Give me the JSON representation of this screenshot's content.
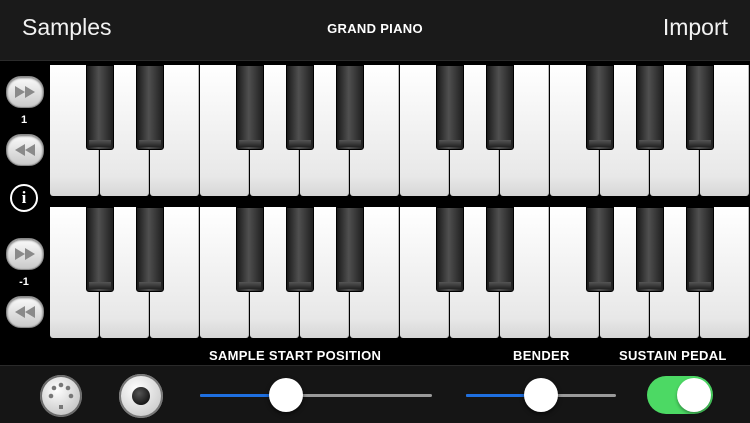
{
  "header": {
    "samples_label": "Samples",
    "title": "GRAND PIANO",
    "import_label": "Import"
  },
  "octave_controls": [
    {
      "name": "upper",
      "value": "1"
    },
    {
      "name": "lower",
      "value": "-1"
    }
  ],
  "info_label": "i",
  "keyboards": [
    {
      "name": "upper",
      "white_keys": 14
    },
    {
      "name": "lower",
      "white_keys": 14
    }
  ],
  "controls": {
    "sample_start_label": "SAMPLE START POSITION",
    "sample_start_value": 0.37,
    "bender_label": "BENDER",
    "bender_value": 0.5,
    "sustain_label": "SUSTAIN PEDAL",
    "sustain_on": true
  },
  "colors": {
    "accent": "#1e6fe0",
    "toggle_on": "#4cd964"
  },
  "icons": {
    "midi": "midi-din-icon",
    "record": "record-icon",
    "forward": "fast-forward-icon",
    "rewind": "rewind-icon"
  }
}
